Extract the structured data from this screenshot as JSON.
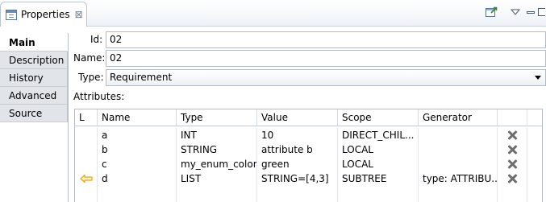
{
  "view_tab": {
    "title": "Properties",
    "close_glyph": "⊠"
  },
  "toolbar": {
    "pin_icon": "pin-icon",
    "menu_icon": "view-menu-icon",
    "minimize_icon": "minimize-icon",
    "maximize_icon": "maximize-icon"
  },
  "side_tabs": [
    {
      "label": "Main",
      "active": true
    },
    {
      "label": "Description",
      "active": false
    },
    {
      "label": "History",
      "active": false
    },
    {
      "label": "Advanced",
      "active": false
    },
    {
      "label": "Source",
      "active": false
    }
  ],
  "form": {
    "id_label": "Id:",
    "id_value": "02",
    "name_label": "Name:",
    "name_value": "02",
    "type_label": "Type:",
    "type_value": "Requirement",
    "attributes_label": "Attributes:"
  },
  "table": {
    "headers": [
      "L",
      "Name",
      "Type",
      "Value",
      "Scope",
      "Generator"
    ],
    "rows": [
      {
        "linked": false,
        "name": "a",
        "type": "INT",
        "value": "10",
        "scope": "DIRECT_CHIL...",
        "generator": ""
      },
      {
        "linked": false,
        "name": "b",
        "type": "STRING",
        "value": "attribute b",
        "scope": "LOCAL",
        "generator": ""
      },
      {
        "linked": false,
        "name": "c",
        "type": "my_enum_color",
        "value": "green",
        "scope": "LOCAL",
        "generator": ""
      },
      {
        "linked": true,
        "name": "d",
        "type": "LIST",
        "value": "STRING=[4,3]",
        "scope": "SUBTREE",
        "generator": "type: ATTRIBU..."
      }
    ]
  },
  "colors": {
    "link_arrow": "#e8a317",
    "delete_icon": "#6e6e6e",
    "tab_border": "#b8c3d0"
  }
}
